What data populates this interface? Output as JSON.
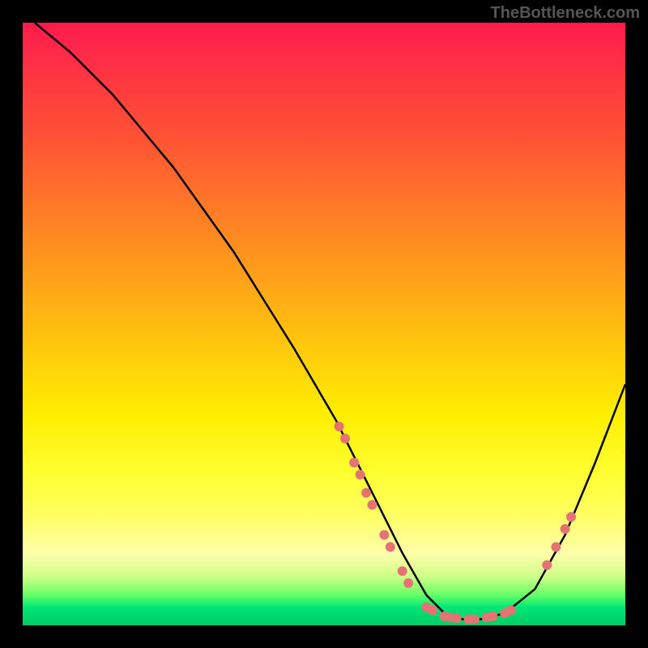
{
  "watermark": "TheBottleneck.com",
  "chart_data": {
    "type": "line",
    "title": "",
    "xlabel": "",
    "ylabel": "",
    "xlim": [
      0,
      100
    ],
    "ylim": [
      0,
      100
    ],
    "series": [
      {
        "name": "curve",
        "x": [
          2,
          8,
          15,
          25,
          35,
          45,
          52,
          58,
          63,
          67,
          70,
          73,
          76,
          80,
          85,
          90,
          95,
          100
        ],
        "values": [
          100,
          95,
          88,
          76,
          62,
          46,
          34,
          22,
          12,
          5,
          2,
          1,
          1,
          2,
          6,
          15,
          27,
          40
        ]
      }
    ],
    "markers": [
      {
        "x": 52.5,
        "y": 33
      },
      {
        "x": 53.5,
        "y": 31
      },
      {
        "x": 55,
        "y": 27
      },
      {
        "x": 56,
        "y": 25
      },
      {
        "x": 57,
        "y": 22
      },
      {
        "x": 58,
        "y": 20
      },
      {
        "x": 60,
        "y": 15
      },
      {
        "x": 61,
        "y": 13
      },
      {
        "x": 63,
        "y": 9
      },
      {
        "x": 64,
        "y": 7
      },
      {
        "x": 67,
        "y": 3
      },
      {
        "x": 68,
        "y": 2.5
      },
      {
        "x": 70,
        "y": 1.5
      },
      {
        "x": 71,
        "y": 1.3
      },
      {
        "x": 72,
        "y": 1.2
      },
      {
        "x": 74,
        "y": 1
      },
      {
        "x": 75,
        "y": 1
      },
      {
        "x": 77,
        "y": 1.3
      },
      {
        "x": 78,
        "y": 1.5
      },
      {
        "x": 80,
        "y": 2
      },
      {
        "x": 81,
        "y": 2.5
      },
      {
        "x": 87,
        "y": 10
      },
      {
        "x": 88.5,
        "y": 13
      },
      {
        "x": 90,
        "y": 16
      },
      {
        "x": 91,
        "y": 18
      }
    ],
    "curve_color": "#000000",
    "marker_color": "#e67373",
    "background_gradient": [
      "#ff1a4d",
      "#ffee00",
      "#00cc66"
    ]
  }
}
